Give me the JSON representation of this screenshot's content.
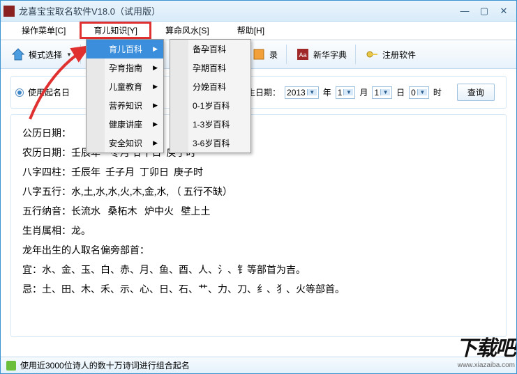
{
  "window": {
    "title": "龙喜宝宝取名软件V18.0（试用版）"
  },
  "menubar": {
    "items": [
      {
        "label": "操作菜单[C]"
      },
      {
        "label": "育儿知识[Y]"
      },
      {
        "label": "算命风水[S]"
      },
      {
        "label": "帮助[H]"
      }
    ]
  },
  "toolbar": {
    "mode_select": "模式选择",
    "record": "录",
    "xinhua": "新华字典",
    "register": "注册软件"
  },
  "submenu1": {
    "items": [
      {
        "label": "育儿百科",
        "has_children": true,
        "hovered": true
      },
      {
        "label": "孕育指南",
        "has_children": true
      },
      {
        "label": "儿童教育",
        "has_children": true
      },
      {
        "label": "营养知识",
        "has_children": true
      },
      {
        "label": "健康讲座",
        "has_children": true
      },
      {
        "label": "安全知识",
        "has_children": true
      }
    ]
  },
  "submenu2": {
    "items": [
      {
        "label": "备孕百科"
      },
      {
        "label": "孕期百科"
      },
      {
        "label": "分娩百科"
      },
      {
        "label": "0-1岁百科"
      },
      {
        "label": "1-3岁百科"
      },
      {
        "label": "3-6岁百科"
      }
    ]
  },
  "filter": {
    "use_label": "使用起名日",
    "birth_label": "出生日期：",
    "year": "2013",
    "year_unit": "年",
    "month": "1",
    "month_unit": "月",
    "day": "1",
    "day_unit": "日",
    "hour": "0",
    "hour_unit": "时",
    "query_btn": "查询"
  },
  "result": {
    "lines": [
      "公历日期：",
      "农历日期：壬辰年　冬月 廿十日  庚子时",
      "八字四柱：壬辰年  壬子月  丁卯日  庚子时",
      "八字五行：水,土,水,水,火,木,金,水, （ 五行不缺）",
      "五行纳音：长流水   桑柘木   炉中火   壁上土",
      "生肖属相：龙。",
      "龙年出生的人取名偏旁部首：",
      "宜：水、金、玉、白、赤、月、鱼、酉、人、氵、钅等部首为吉。",
      "忌：土、田、木、禾、示、心、日、石、艹、力、刀、纟、犭、火等部首。"
    ]
  },
  "statusbar": {
    "text": "使用近3000位诗人的数十万诗词进行组合起名"
  },
  "watermark": {
    "big": "下载吧",
    "url": "www.xiazaiba.com"
  }
}
